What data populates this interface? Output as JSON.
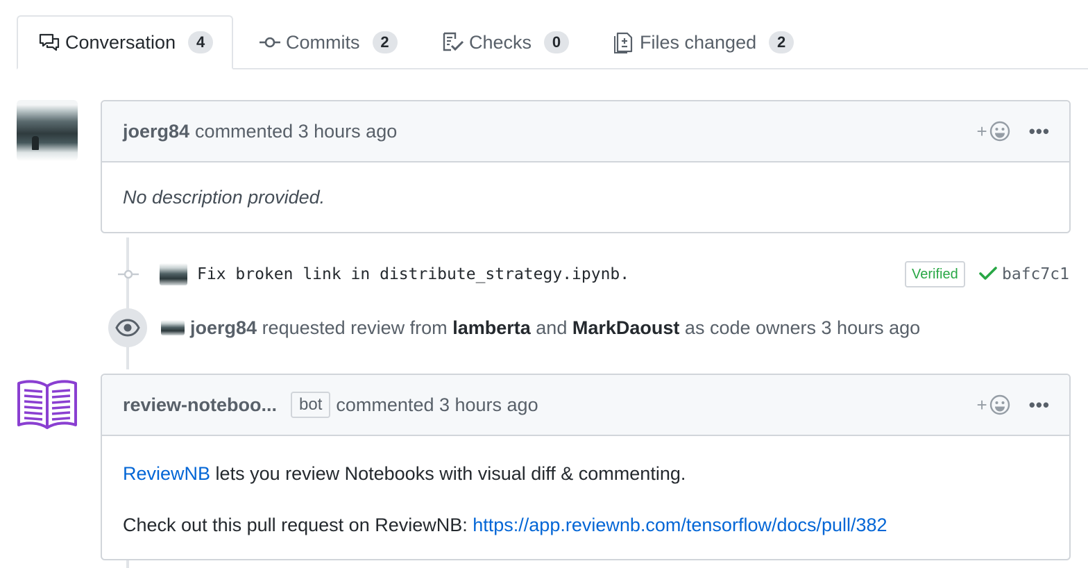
{
  "tabs": [
    {
      "label": "Conversation",
      "count": "4",
      "icon": "comment-discussion-icon",
      "active": true
    },
    {
      "label": "Commits",
      "count": "2",
      "icon": "git-commit-icon",
      "active": false
    },
    {
      "label": "Checks",
      "count": "0",
      "icon": "checklist-icon",
      "active": false
    },
    {
      "label": "Files changed",
      "count": "2",
      "icon": "diff-icon",
      "active": false
    }
  ],
  "comment1": {
    "author": "joerg84",
    "action": "commented 3 hours ago",
    "body": "No description provided."
  },
  "commit": {
    "message": "Fix broken link in distribute_strategy.ipynb.",
    "verified_label": "Verified",
    "sha": "bafc7c1"
  },
  "review_event": {
    "actor": "joerg84",
    "text1": "requested review from",
    "reviewer1": "lamberta",
    "text2": "and",
    "reviewer2": "MarkDaoust",
    "text3": "as code owners 3 hours ago"
  },
  "comment2": {
    "author": "review-noteboo...",
    "bot_label": "bot",
    "action": "commented 3 hours ago",
    "body_link_text": "ReviewNB",
    "body_text": " lets you review Notebooks with visual diff & commenting.",
    "body2_prefix": "Check out this pull request on ReviewNB: ",
    "body2_link": "https://app.reviewnb.com/tensorflow/docs/pull/382"
  },
  "actions": {
    "reaction_plus": "+",
    "more": "•••"
  },
  "colors": {
    "accent_link": "#0366d6",
    "verified_green": "#28a745",
    "bot_purple": "#8a3fd1",
    "border": "#d1d5da"
  }
}
